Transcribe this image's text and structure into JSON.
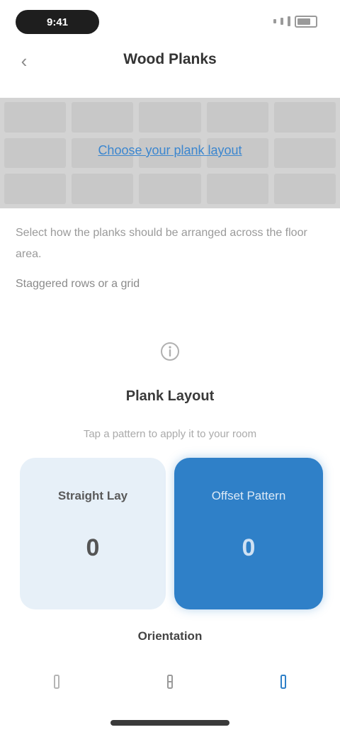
{
  "status_bar": {
    "time": "9:41"
  },
  "nav": {
    "title": "Wood Planks"
  },
  "banner": {
    "link_text": "Choose your plank layout"
  },
  "body": {
    "description": "Select how the planks should be arranged across the floor area.",
    "subtext": "Staggered rows or a grid"
  },
  "layout_section": {
    "title": "Plank Layout",
    "subtitle": "Tap a pattern to apply it to your room"
  },
  "options": [
    {
      "label": "Straight Lay",
      "value": "0"
    },
    {
      "label": "Offset Pattern",
      "value": "0"
    }
  ],
  "bottom": {
    "title": "Orientation"
  },
  "tabs": [
    {
      "icon": "horizontal-icon"
    },
    {
      "icon": "vertical-icon"
    },
    {
      "icon": "diagonal-icon"
    }
  ],
  "colors": {
    "accent": "#2f80c8",
    "accent_light": "#e7f0f8",
    "link": "#3b86cf",
    "banner": "#d3d3d3"
  }
}
